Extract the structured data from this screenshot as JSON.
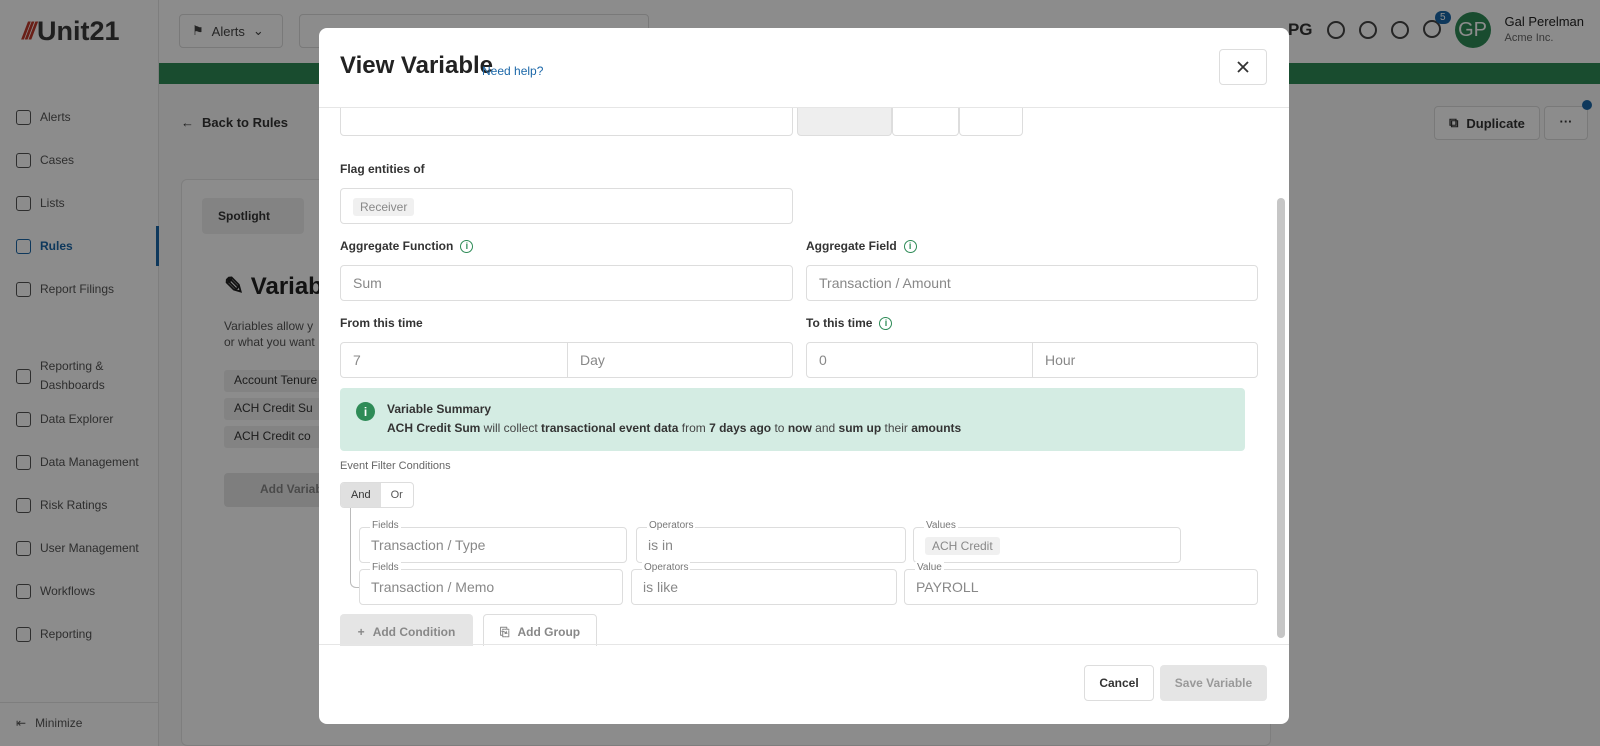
{
  "app": {
    "logo_mark": "///",
    "logo_text": "Unit21"
  },
  "sidebar": {
    "items": [
      {
        "label": "Alerts",
        "icon": "flag-icon"
      },
      {
        "label": "Cases",
        "icon": "briefcase-icon"
      },
      {
        "label": "Lists",
        "icon": "list-icon"
      },
      {
        "label": "Rules",
        "icon": "scale-icon",
        "active": true
      },
      {
        "label": "Report Filings",
        "icon": "building-icon"
      },
      {
        "label": "Reporting &",
        "label2": "Dashboards",
        "icon": "chart-icon"
      },
      {
        "label": "Data Explorer",
        "icon": "search-data-icon"
      },
      {
        "label": "Data Management",
        "icon": "database-icon"
      },
      {
        "label": "Risk Ratings",
        "icon": "warning-icon"
      },
      {
        "label": "User Management",
        "icon": "users-icon"
      },
      {
        "label": "Workflows",
        "icon": "workflow-icon"
      },
      {
        "label": "Reporting",
        "icon": "report-icon"
      }
    ],
    "minimize_label": "Minimize"
  },
  "topbar": {
    "alerts_dropdown": "Alerts",
    "pg_label": "PG",
    "notification_count": "5",
    "avatar_initials": "GP",
    "user_name": "Gal Perelman",
    "user_org": "Acme Inc."
  },
  "background": {
    "back_label": "Back to Rules",
    "duplicate_label": "Duplicate",
    "more_label": "···",
    "spotlight_label": "Spotlight",
    "section_title": "Variab",
    "desc_line1": "Variables allow y",
    "desc_line2": "or what you want",
    "variables": [
      "Account Tenure",
      "ACH Credit Su",
      "ACH Credit co"
    ],
    "add_variable_label": "Add Variab"
  },
  "modal": {
    "title": "View Variable",
    "help_link": "Need help?",
    "flag_entities_label": "Flag entities of",
    "flag_entities_value": "Receiver",
    "aggregate_function_label": "Aggregate Function",
    "aggregate_function_value": "Sum",
    "aggregate_field_label": "Aggregate Field",
    "aggregate_field_value": "Transaction / Amount",
    "from_time_label": "From this time",
    "from_time_amount": "7",
    "from_time_unit": "Day",
    "to_time_label": "To this time",
    "to_time_amount": "0",
    "to_time_unit": "Hour",
    "summary": {
      "title": "Variable Summary",
      "name": "ACH Credit Sum",
      "t1": " will collect ",
      "b1": "transactional event data",
      "t2": " from ",
      "b2": "7 days ago",
      "t3": " to ",
      "b3": "now",
      "t4": " and ",
      "b4": "sum up",
      "t5": " their ",
      "b5": "amounts"
    },
    "event_filter_label": "Event Filter Conditions",
    "logic_and": "And",
    "logic_or": "Or",
    "conditions": [
      {
        "field_caption": "Fields",
        "field": "Transaction / Type",
        "op_caption": "Operators",
        "operator": "is in",
        "value_caption": "Values",
        "value": "ACH Credit"
      },
      {
        "field_caption": "Fields",
        "field": "Transaction / Memo",
        "op_caption": "Operators",
        "operator": "is like",
        "value_caption": "Value",
        "value": "PAYROLL"
      }
    ],
    "add_condition_label": "Add Condition",
    "add_group_label": "Add Group",
    "cancel_label": "Cancel",
    "save_label": "Save Variable"
  },
  "colors": {
    "brand_red": "#c0392b",
    "accent_blue": "#1b67a8",
    "accent_green": "#2e8b57",
    "summary_bg": "#d4ece3"
  }
}
